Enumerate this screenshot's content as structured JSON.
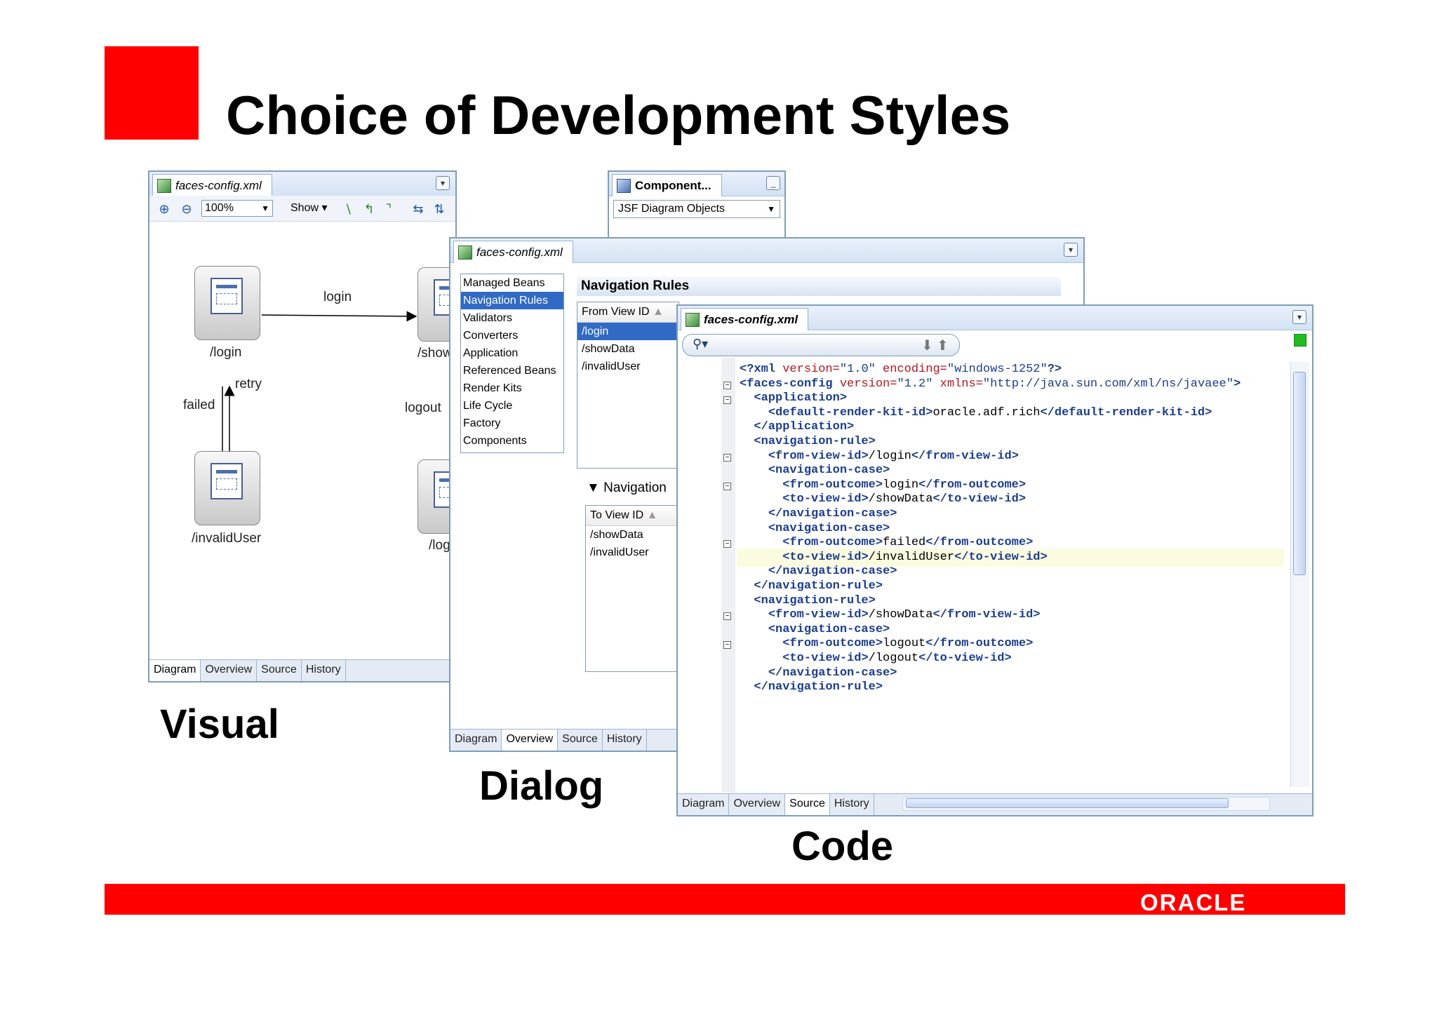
{
  "slide": {
    "title": "Choice of Development Styles",
    "captions": {
      "visual": "Visual",
      "dialog": "Dialog",
      "code": "Code"
    },
    "logo_text": "ORACLE",
    "accent_color": "#ff0000"
  },
  "visual_window": {
    "tab_title": "faces-config.xml",
    "zoom_value": "100%",
    "show_label": "Show",
    "component_panel_title": "Component...",
    "component_panel_select": "JSF Diagram Objects",
    "nodes": {
      "login": "/login",
      "show": "/show",
      "invalid_user": "/invalidUser",
      "logout": "/log"
    },
    "edges": {
      "login": "login",
      "retry": "retry",
      "failed": "failed",
      "logout": "logout"
    },
    "bottom_tabs": [
      "Diagram",
      "Overview",
      "Source",
      "History"
    ]
  },
  "dialog_window": {
    "tab_title": "faces-config.xml",
    "categories": [
      "Managed Beans",
      "Navigation Rules",
      "Validators",
      "Converters",
      "Application",
      "Referenced Beans",
      "Render Kits",
      "Life Cycle",
      "Factory",
      "Components"
    ],
    "selected_category": "Navigation Rules",
    "heading": "Navigation Rules",
    "from_column": "From View ID",
    "from_rows": [
      "/login",
      "/showData",
      "/invalidUser"
    ],
    "cases_heading": "Navigation",
    "to_column": "To View ID",
    "to_rows": [
      "/showData",
      "/invalidUser"
    ],
    "bottom_tabs": [
      "Diagram",
      "Overview",
      "Source",
      "History"
    ]
  },
  "code_window": {
    "tab_title": "faces-config.xml",
    "bottom_tabs": [
      "Diagram",
      "Overview",
      "Source",
      "History"
    ],
    "lines": [
      "<?xml version=\"1.0\" encoding=\"windows-1252\"?>",
      "<faces-config version=\"1.2\" xmlns=\"http://java.sun.com/xml/ns/javaee\">",
      "  <application>",
      "    <default-render-kit-id>oracle.adf.rich</default-render-kit-id>",
      "  </application>",
      "  <navigation-rule>",
      "    <from-view-id>/login</from-view-id>",
      "    <navigation-case>",
      "      <from-outcome>login</from-outcome>",
      "      <to-view-id>/showData</to-view-id>",
      "    </navigation-case>",
      "    <navigation-case>",
      "      <from-outcome>failed</from-outcome>",
      "      <to-view-id>/invalidUser</to-view-id>",
      "    </navigation-case>",
      "  </navigation-rule>",
      "  <navigation-rule>",
      "    <from-view-id>/showData</from-view-id>",
      "    <navigation-case>",
      "      <from-outcome>logout</from-outcome>",
      "      <to-view-id>/logout</to-view-id>",
      "    </navigation-case>",
      "  </navigation-rule>"
    ]
  }
}
